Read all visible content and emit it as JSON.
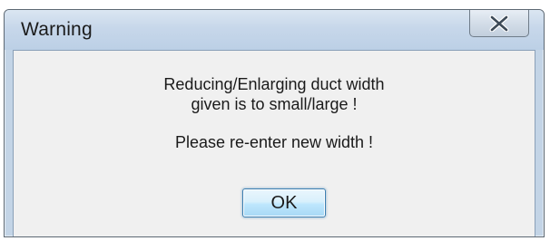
{
  "window": {
    "title": "Warning",
    "close_icon": "close-icon"
  },
  "message": {
    "line1": "Reducing/Enlarging duct width",
    "line2": "given is to small/large !",
    "line3": "Please re-enter new width !"
  },
  "buttons": {
    "ok_label": "OK"
  },
  "colors": {
    "title_bar": "#c7d7ea",
    "client_bg": "#f0f0f0",
    "ok_button_border": "#3c7fb1"
  }
}
